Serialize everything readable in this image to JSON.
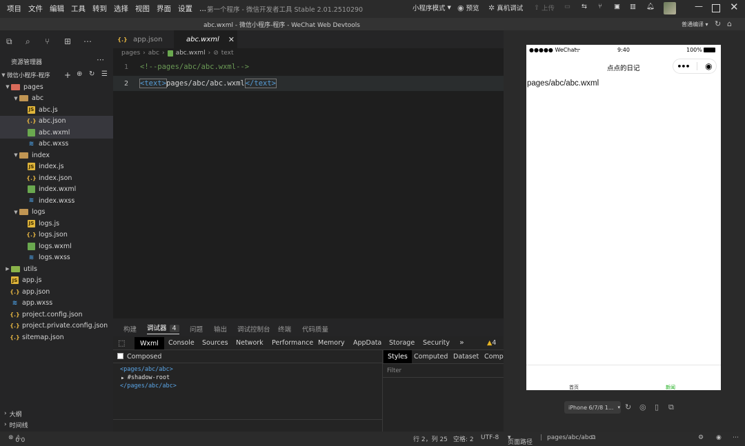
{
  "menu": {
    "items": [
      "项目",
      "文件",
      "编辑",
      "工具",
      "转到",
      "选择",
      "视图",
      "界面",
      "设置",
      "..."
    ],
    "window_title": "第一个程序 - 微信开发者工具 Stable 2.01.2510290",
    "mode": "小程序模式",
    "preview": "预览",
    "remote_debug": "真机调试",
    "upload": "上传"
  },
  "subbar": {
    "title": "abc.wxml - 微信小程序-程序 - WeChat Web Devtools",
    "compile_mode": "普通编译"
  },
  "explorer": {
    "title": "资源管理器",
    "project": "微信小程序-程序",
    "tree": [
      {
        "label": "pages",
        "type": "folder-red",
        "depth": 1,
        "arrow": "▼"
      },
      {
        "label": "abc",
        "type": "folder",
        "depth": 2,
        "arrow": "▼"
      },
      {
        "label": "abc.js",
        "type": "js",
        "depth": 3
      },
      {
        "label": "abc.json",
        "type": "json",
        "depth": 3,
        "selected": true
      },
      {
        "label": "abc.wxml",
        "type": "wxml",
        "depth": 3,
        "selected": true
      },
      {
        "label": "abc.wxss",
        "type": "wxss",
        "depth": 3
      },
      {
        "label": "index",
        "type": "folder",
        "depth": 2,
        "arrow": "▼"
      },
      {
        "label": "index.js",
        "type": "js",
        "depth": 3
      },
      {
        "label": "index.json",
        "type": "json",
        "depth": 3
      },
      {
        "label": "index.wxml",
        "type": "wxml",
        "depth": 3
      },
      {
        "label": "index.wxss",
        "type": "wxss",
        "depth": 3
      },
      {
        "label": "logs",
        "type": "folder",
        "depth": 2,
        "arrow": "▼"
      },
      {
        "label": "logs.js",
        "type": "js",
        "depth": 3
      },
      {
        "label": "logs.json",
        "type": "json",
        "depth": 3
      },
      {
        "label": "logs.wxml",
        "type": "wxml",
        "depth": 3
      },
      {
        "label": "logs.wxss",
        "type": "wxss",
        "depth": 3
      },
      {
        "label": "utils",
        "type": "folder-green",
        "depth": 1,
        "arrow": "▶"
      },
      {
        "label": "app.js",
        "type": "js",
        "depth": 1
      },
      {
        "label": "app.json",
        "type": "json",
        "depth": 1
      },
      {
        "label": "app.wxss",
        "type": "wxss",
        "depth": 1
      },
      {
        "label": "project.config.json",
        "type": "json",
        "depth": 1
      },
      {
        "label": "project.private.config.json",
        "type": "json",
        "depth": 1
      },
      {
        "label": "sitemap.json",
        "type": "json",
        "depth": 1
      }
    ],
    "outline": "大纲",
    "timeline": "时间线"
  },
  "editor": {
    "tabs": [
      {
        "label": "app.json",
        "active": false
      },
      {
        "label": "abc.wxml",
        "active": true
      }
    ],
    "breadcrumb": [
      "pages",
      "abc",
      "abc.wxml",
      "text"
    ],
    "lines": [
      {
        "n": "1",
        "comment": "<!--pages/abc/abc.wxml-->"
      },
      {
        "n": "2",
        "open": "<text>",
        "body": "pages/abc/abc.wxml",
        "close": "</text>"
      }
    ]
  },
  "debug": {
    "tabs": [
      "构建",
      "调试器",
      "问题",
      "输出",
      "调试控制台",
      "终端",
      "代码质量"
    ],
    "active_tab": "调试器",
    "badge": "4",
    "devtools_tabs": [
      "Wxml",
      "Console",
      "Sources",
      "Network",
      "Performance",
      "Memory",
      "AppData",
      "Storage",
      "Security"
    ],
    "warnings": "4",
    "composed_label": "Composed",
    "dom": [
      "<pages/abc/abc>",
      "#shadow-root",
      "</pages/abc/abc>"
    ],
    "style_tabs": [
      "Styles",
      "Computed",
      "Dataset",
      "Compo"
    ],
    "filter_placeholder": "Filter"
  },
  "status": {
    "errors": "0",
    "warnings": "0",
    "position": "行 2，列 25",
    "spaces": "空格: 2",
    "encoding": "UTF-8",
    "page_path_label": "页面路径",
    "page_path": "pages/abc/abc"
  },
  "simulator": {
    "carrier": "●●●●● WeChat",
    "time": "9:40",
    "battery": "100%",
    "nav_title": "点点的日记",
    "content": "pages/abc/abc.wxml",
    "tabbar": [
      "首页",
      "新闻"
    ],
    "tabbar_active_color": "#1aad19",
    "device": "iPhone 6/7/8 1..."
  }
}
